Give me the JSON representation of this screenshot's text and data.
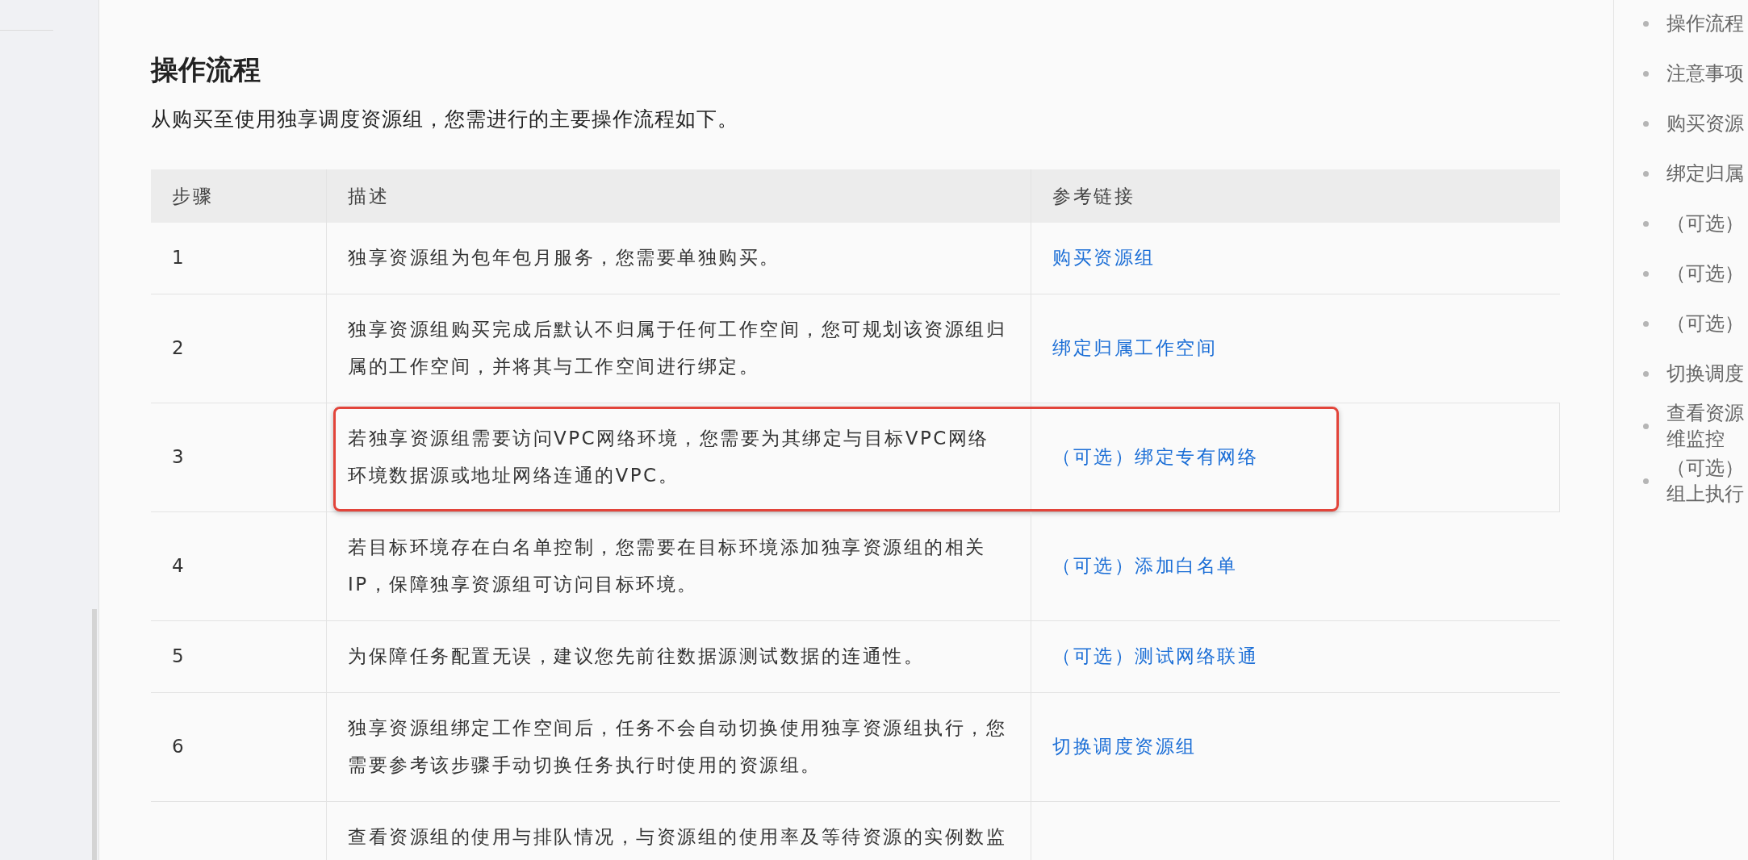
{
  "section": {
    "heading": "操作流程",
    "intro": "从购买至使用独享调度资源组，您需进行的主要操作流程如下。"
  },
  "table": {
    "columns": [
      "步骤",
      "描述",
      "参考链接"
    ],
    "rows": [
      {
        "step": "1",
        "description": "独享资源组为包年包月服务，您需要单独购买。",
        "link": "购买资源组"
      },
      {
        "step": "2",
        "description": "独享资源组购买完成后默认不归属于任何工作空间，您可规划该资源组归属的工作空间，并将其与工作空间进行绑定。",
        "link": "绑定归属工作空间"
      },
      {
        "step": "3",
        "description": "若独享资源组需要访问VPC网络环境，您需要为其绑定与目标VPC网络环境数据源或地址网络连通的VPC。",
        "link": "（可选）绑定专有网络",
        "highlighted": true
      },
      {
        "step": "4",
        "description": "若目标环境存在白名单控制，您需要在目标环境添加独享资源组的相关IP，保障独享资源组可访问目标环境。",
        "link": "（可选）添加白名单"
      },
      {
        "step": "5",
        "description": "为保障任务配置无误，建议您先前往数据源测试数据的连通性。",
        "link": "（可选）测试网络联通"
      },
      {
        "step": "6",
        "description": "独享资源组绑定工作空间后，任务不会自动切换使用独享资源组执行，您需要参考该步骤手动切换任务执行时使用的资源组。",
        "link": "切换调度资源组"
      },
      {
        "description": "查看资源组的使用与排队情况，与资源组的使用率及等待资源的实例数监"
      }
    ]
  },
  "toc": {
    "items": [
      {
        "lines": [
          "操作流程"
        ]
      },
      {
        "lines": [
          "注意事项"
        ]
      },
      {
        "lines": [
          "购买资源"
        ]
      },
      {
        "lines": [
          "绑定归属"
        ]
      },
      {
        "lines": [
          "（可选）"
        ]
      },
      {
        "lines": [
          "（可选）"
        ]
      },
      {
        "lines": [
          "（可选）"
        ]
      },
      {
        "lines": [
          "切换调度"
        ]
      },
      {
        "lines": [
          "查看资源",
          "维监控"
        ]
      },
      {
        "lines": [
          "（可选）",
          "组上执行"
        ]
      }
    ]
  }
}
